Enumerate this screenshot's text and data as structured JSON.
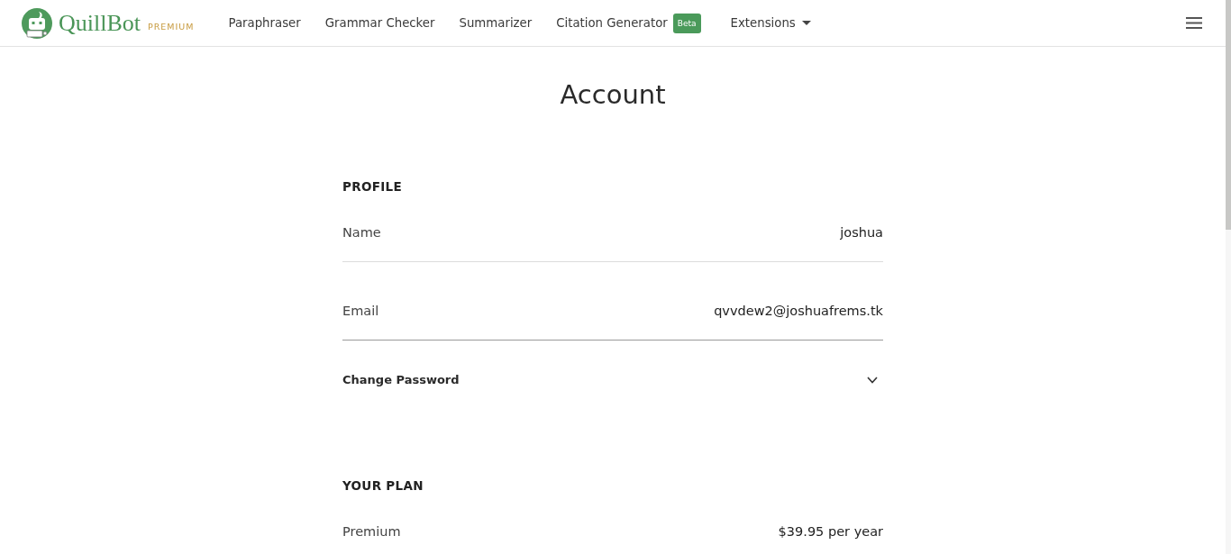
{
  "header": {
    "logo": {
      "name": "QuillBot",
      "tier": "PREMIUM"
    },
    "nav": [
      {
        "kind": "link",
        "label": "Paraphraser"
      },
      {
        "kind": "link",
        "label": "Grammar Checker"
      },
      {
        "kind": "link",
        "label": "Summarizer"
      },
      {
        "kind": "link",
        "label": "Citation Generator",
        "badge": "Beta"
      },
      {
        "kind": "dropdown",
        "label": "Extensions"
      }
    ]
  },
  "page": {
    "title": "Account"
  },
  "sections": [
    {
      "heading": "PROFILE",
      "rows": [
        {
          "kind": "field",
          "label": "Name",
          "value": "joshua"
        },
        {
          "kind": "field",
          "label": "Email",
          "value": "qvvdew2@joshuafrems.tk"
        },
        {
          "kind": "expander",
          "label": "Change Password",
          "expanded": false
        }
      ]
    },
    {
      "heading": "YOUR PLAN",
      "rows": [
        {
          "kind": "field",
          "label": "Premium",
          "value": "$39.95 per year"
        }
      ]
    }
  ]
}
